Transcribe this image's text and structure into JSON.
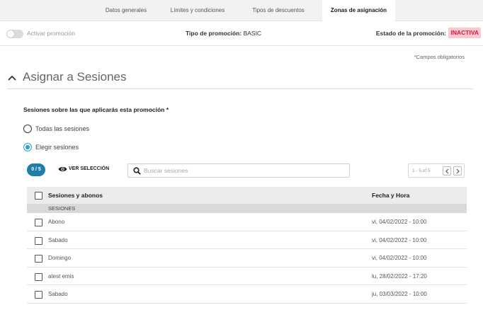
{
  "tabs": [
    {
      "label": "Datos generales",
      "active": false
    },
    {
      "label": "Límites y condiciones",
      "active": false
    },
    {
      "label": "Tipos de descuentos",
      "active": false
    },
    {
      "label": "Zonas de asignación",
      "active": true
    }
  ],
  "promo_bar": {
    "toggle_label": "Activar promoción",
    "toggle_on": false,
    "type_label": "Tipo de promoción:",
    "type_value": "BASIC",
    "state_label": "Estado de la promoción:",
    "state_value": "INACTIVA"
  },
  "required_note": "*Campos obligatorios",
  "section": {
    "title": "Asignar a Sesiones",
    "question": "Sesiones sobre las que aplicarás esta promoción *",
    "options": [
      {
        "label": "Todas las sesiones",
        "selected": false
      },
      {
        "label": "Elegir sesiones",
        "selected": true
      }
    ]
  },
  "toolbar": {
    "selected_count": "0 / 5",
    "view_selection": "VER SELECCIÓN",
    "search_placeholder": "Buscar sesiones",
    "search_value": "",
    "pagination": "1 - 5 of 5"
  },
  "table": {
    "headers": [
      "Sesiones y abonos",
      "Fecha y Hora"
    ],
    "group": "SESIONES",
    "rows": [
      {
        "name": "Abono",
        "date": "vi, 04/02/2022 - 10:00"
      },
      {
        "name": "Sabado",
        "date": "vi, 04/02/2022 - 10:00"
      },
      {
        "name": "Domingo",
        "date": "vi, 04/02/2022 - 10:00"
      },
      {
        "name": "atest emis",
        "date": "lu, 28/02/2022 - 17:20"
      },
      {
        "name": "Sabado",
        "date": "ju, 03/03/2022 - 10:00"
      }
    ]
  },
  "colors": {
    "accent": "#2aa4c9",
    "counter_bg": "#1f7ea8",
    "inactive_badge_bg": "#f8c9d2",
    "inactive_badge_text": "#d61a3c"
  },
  "icons": {
    "chevron": "chevron-up-icon",
    "eye": "eye-icon",
    "search": "search-icon",
    "prev": "chevron-left-icon",
    "next": "chevron-right-icon"
  }
}
